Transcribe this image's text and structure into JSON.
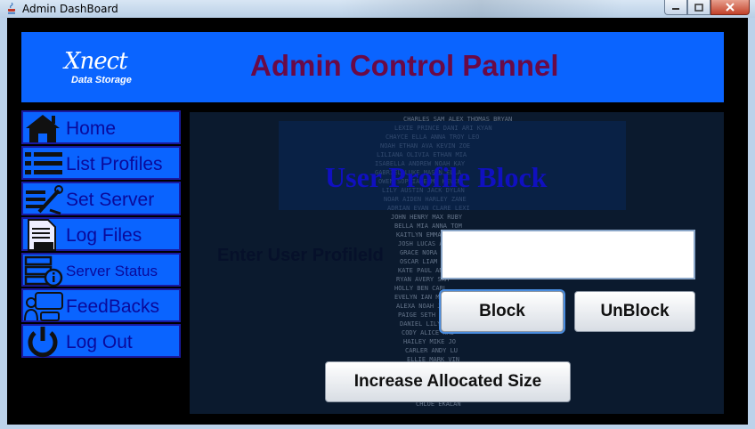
{
  "window": {
    "title": "Admin DashBoard"
  },
  "header": {
    "logo_main": "Xnect",
    "logo_sub": "Data Storage",
    "title": "Admin Control Pannel"
  },
  "sidebar": {
    "items": [
      {
        "label": "Home",
        "icon": "home-icon"
      },
      {
        "label": "List Profiles",
        "icon": "list-icon"
      },
      {
        "label": "Set Server",
        "icon": "tools-icon"
      },
      {
        "label": "Log Files",
        "icon": "log-file-icon"
      },
      {
        "label": "Server Status",
        "icon": "server-status-icon"
      },
      {
        "label": "FeedBacks",
        "icon": "feedback-icon"
      },
      {
        "label": "Log Out",
        "icon": "power-icon"
      }
    ]
  },
  "main": {
    "subtitle": "User Profile Block",
    "profile_label": "Enter User ProfileId",
    "profile_value": "",
    "block_label": "Block",
    "unblock_label": "UnBlock",
    "increase_label": "Increase Allocated Size"
  },
  "colors": {
    "accent_blue": "#0a64ff",
    "title_maroon": "#6a0a46",
    "nav_text": "#0a0a9a",
    "panel_bg": "#0b1a2e"
  }
}
